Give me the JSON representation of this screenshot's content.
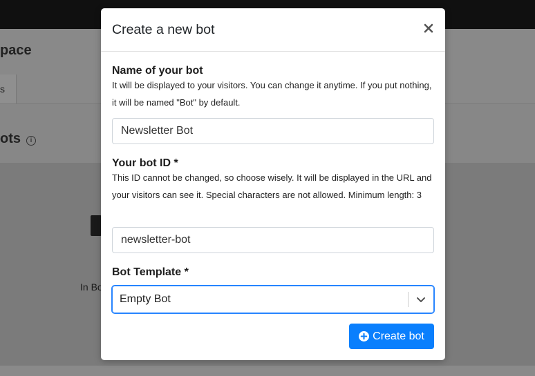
{
  "background": {
    "workspace_title": "pace",
    "tab_label": "s",
    "section_title": "ots",
    "info_icon": "info-circle-icon",
    "item_label": "In Bo"
  },
  "modal": {
    "title": "Create a new bot",
    "close_icon": "close-icon",
    "name_field": {
      "label": "Name of your bot",
      "help": "It will be displayed to your visitors. You can change it anytime. If you put nothing, it will be named \"Bot\" by default.",
      "value": "Newsletter Bot"
    },
    "id_field": {
      "label": "Your bot ID *",
      "help": "This ID cannot be changed, so choose wisely. It will be displayed in the URL and your visitors can see it. Special characters are not allowed. Minimum length: 3",
      "value": "newsletter-bot"
    },
    "template_field": {
      "label": "Bot Template *",
      "selected": "Empty Bot"
    },
    "create_button": {
      "label": "Create bot",
      "icon": "plus-circle-icon",
      "color": "#0a7ffd"
    }
  }
}
